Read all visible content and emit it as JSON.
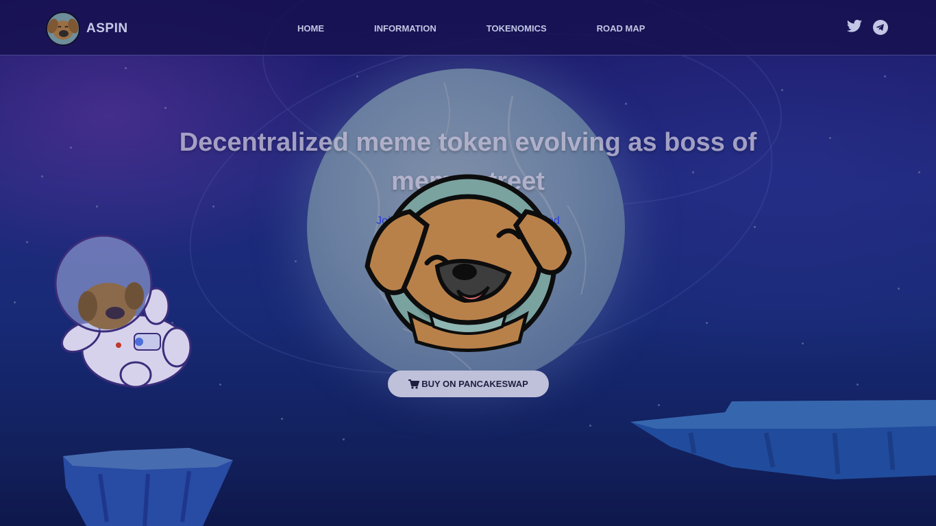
{
  "brand": {
    "name": "ASPIN",
    "logo_icon": "dog-face-logo"
  },
  "nav": {
    "links": [
      {
        "label": "HOME"
      },
      {
        "label": "INFORMATION"
      },
      {
        "label": "TOKENOMICS"
      },
      {
        "label": "ROAD MAP"
      }
    ],
    "social": [
      {
        "icon": "twitter-icon"
      },
      {
        "icon": "telegram-icon"
      }
    ]
  },
  "hero": {
    "title": "Decentralized meme token evolving as boss of meme street",
    "subtitle": "Join our community and get rewarded",
    "buy_button": {
      "label": "BUY ON PANCAKESWAP",
      "icon": "shopping-cart-icon"
    }
  },
  "colors": {
    "background": "#2b3aa6",
    "nav_bg": "#16124f",
    "button_bg": "#bfc0d9",
    "subtitle_link": "#2a3fd8"
  }
}
